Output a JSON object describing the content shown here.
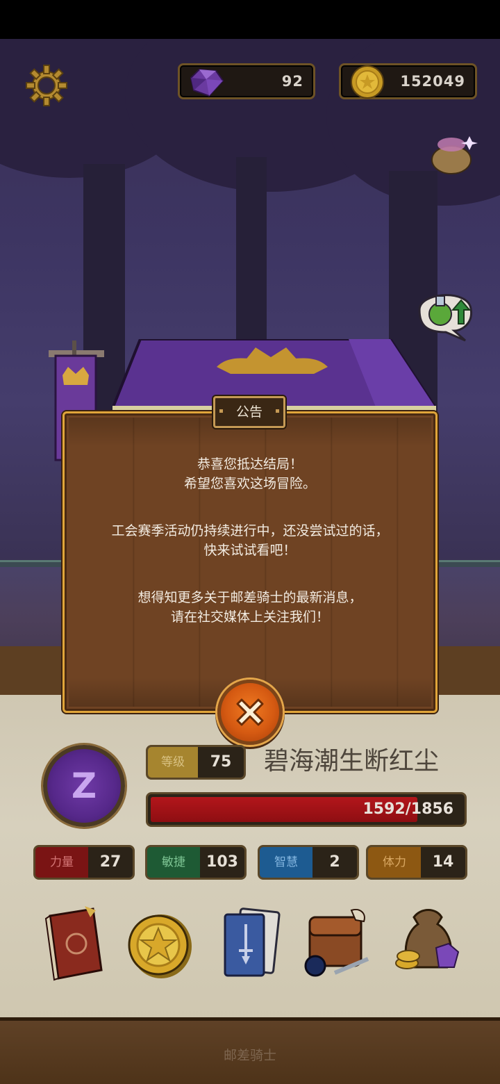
{
  "currency": {
    "gems": "92",
    "coins": "152049"
  },
  "dialog": {
    "title": "公告",
    "lines": [
      "恭喜您抵达结局！",
      "希望您喜欢这场冒险。",
      "工会赛季活动仍持续进行中，还没尝试过的话，",
      "快来试试看吧！",
      "想得知更多关于邮差骑士的最新消息，",
      "请在社交媒体上关注我们！"
    ]
  },
  "player": {
    "emblem_letter": "Z",
    "level_label": "等级",
    "level": "75",
    "name": "碧海潮生断红尘",
    "hp_text": "1592/1856",
    "hp_current": 1592,
    "hp_max": 1856
  },
  "stats": {
    "strength_label": "力量",
    "strength": "27",
    "agility_label": "敏捷",
    "agility": "103",
    "intelligence_label": "智慧",
    "intelligence": "2",
    "vitality_label": "体力",
    "vitality": "14"
  },
  "menu": {
    "icons": [
      "quest-book-icon",
      "star-coin-icon",
      "card-deck-icon",
      "inventory-bag-icon",
      "treasure-sack-icon"
    ]
  },
  "footer": {
    "title": "邮差骑士"
  },
  "colors": {
    "hp_fill": "#b3161b",
    "dialog_wood": "#6f4323",
    "dialog_border": "#e0a53a",
    "close_button": "#e06a1a"
  }
}
